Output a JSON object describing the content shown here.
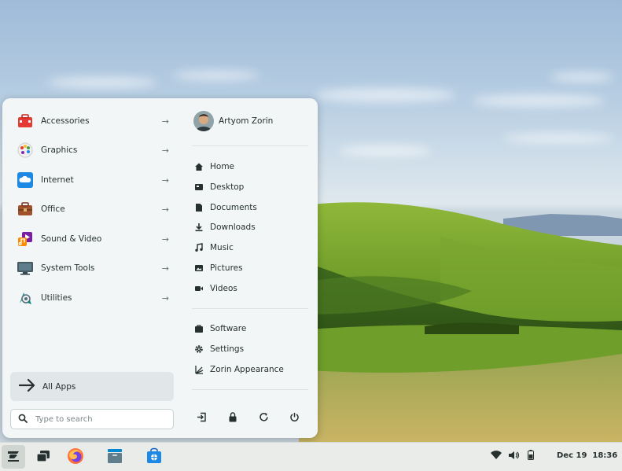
{
  "menu": {
    "categories": [
      {
        "label": "Accessories",
        "icon": "toolbox-icon"
      },
      {
        "label": "Graphics",
        "icon": "palette-icon"
      },
      {
        "label": "Internet",
        "icon": "cloud-icon"
      },
      {
        "label": "Office",
        "icon": "briefcase-icon"
      },
      {
        "label": "Sound & Video",
        "icon": "media-icon"
      },
      {
        "label": "System Tools",
        "icon": "monitor-icon"
      },
      {
        "label": "Utilities",
        "icon": "utilities-icon"
      }
    ],
    "all_apps_label": "All Apps",
    "search": {
      "placeholder": "Type to search",
      "value": ""
    },
    "user": {
      "name": "Artyom Zorin"
    },
    "places": [
      {
        "label": "Home",
        "icon": "home-icon"
      },
      {
        "label": "Desktop",
        "icon": "desktop-icon"
      },
      {
        "label": "Documents",
        "icon": "document-icon"
      },
      {
        "label": "Downloads",
        "icon": "download-icon"
      },
      {
        "label": "Music",
        "icon": "music-icon"
      },
      {
        "label": "Pictures",
        "icon": "picture-icon"
      },
      {
        "label": "Videos",
        "icon": "video-icon"
      }
    ],
    "system": [
      {
        "label": "Software",
        "icon": "software-icon"
      },
      {
        "label": "Settings",
        "icon": "gear-icon"
      },
      {
        "label": "Zorin Appearance",
        "icon": "appearance-icon"
      }
    ],
    "actions": [
      "logout-icon",
      "lock-icon",
      "restart-icon",
      "power-icon"
    ]
  },
  "taskbar": {
    "apps": [
      "zorin-menu-icon",
      "workspaces-icon",
      "firefox-icon",
      "files-icon",
      "software-store-icon"
    ],
    "tray": [
      "wifi-icon",
      "volume-icon",
      "battery-icon"
    ],
    "clock": {
      "date": "Dec 19",
      "time": "18:36"
    }
  },
  "colors": {
    "accent": "#1a7fd6",
    "menu_bg": "#f3f6f7",
    "taskbar_bg": "#e9ece9"
  }
}
